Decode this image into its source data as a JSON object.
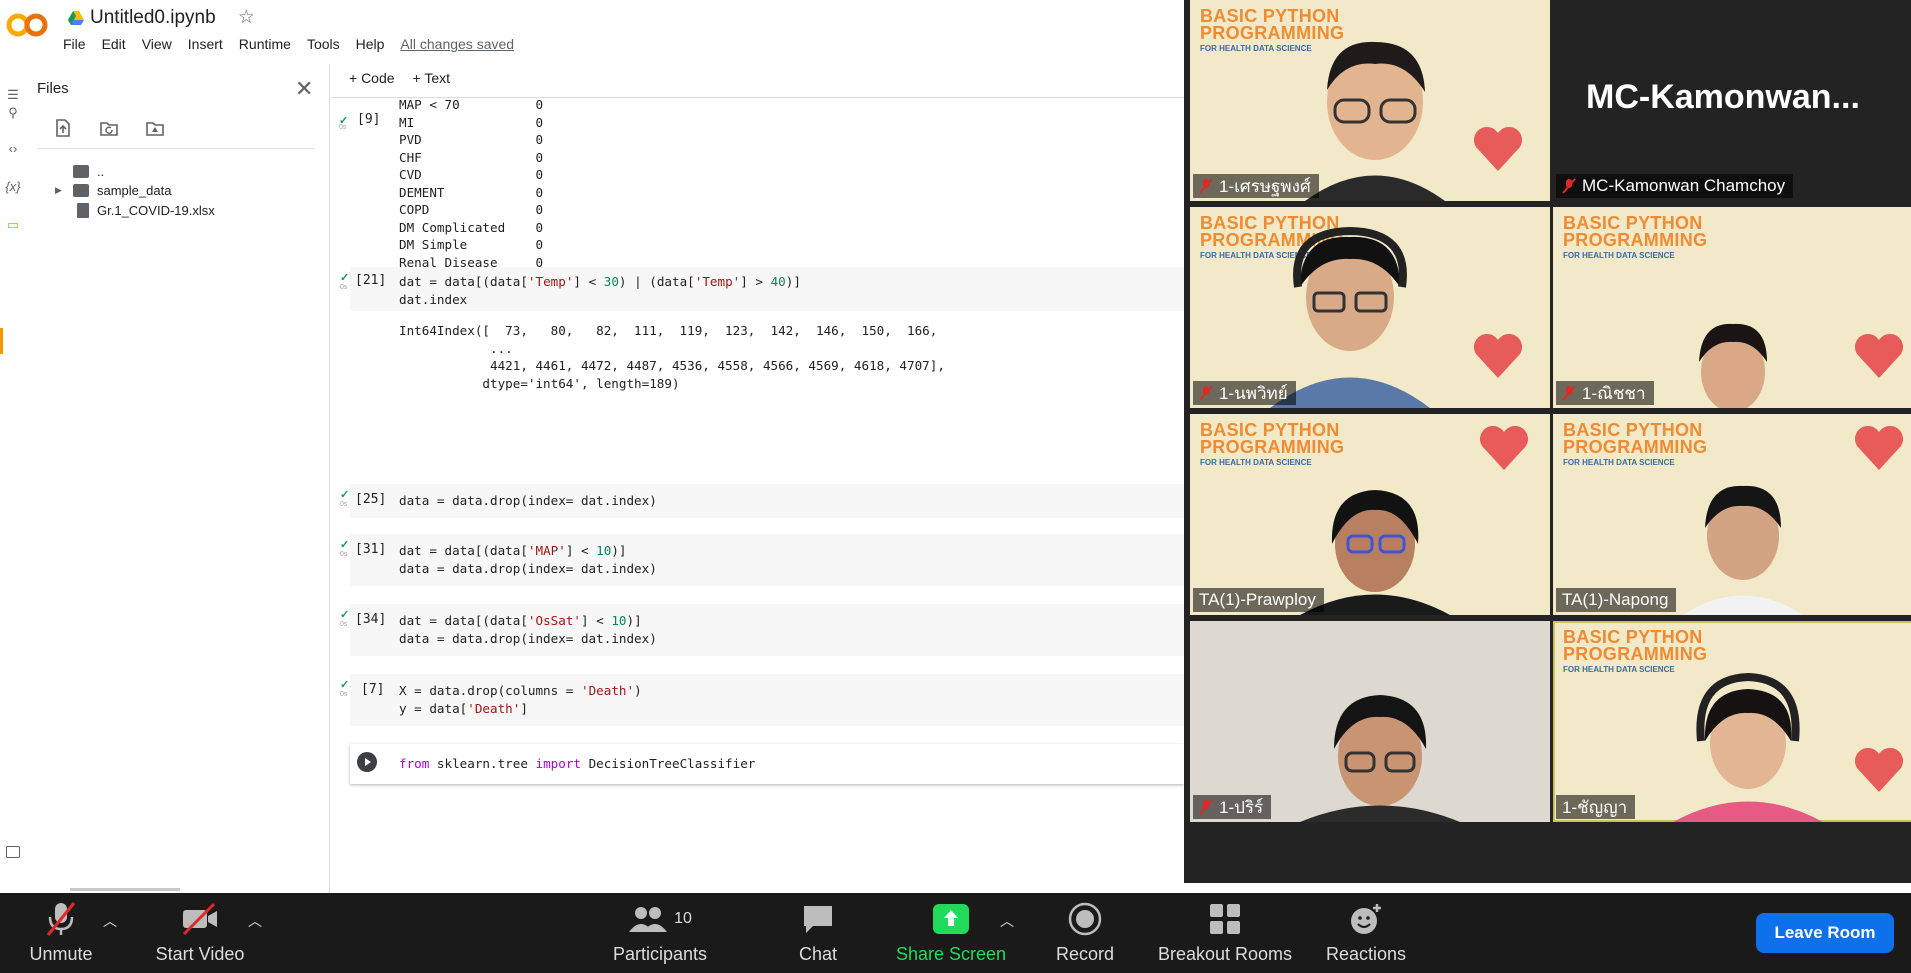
{
  "colab": {
    "title": "Untitled0.ipynb",
    "menu": [
      "File",
      "Edit",
      "View",
      "Insert",
      "Runtime",
      "Tools",
      "Help"
    ],
    "saved_status": "All changes saved",
    "files_panel": {
      "title": "Files",
      "tree": [
        {
          "name": "..",
          "type": "folder-up"
        },
        {
          "name": "sample_data",
          "type": "folder"
        },
        {
          "name": "Gr.1_COVID-19.xlsx",
          "type": "file"
        }
      ]
    },
    "toolbar": {
      "code": "+ Code",
      "text": "+ Text"
    },
    "cells": {
      "c9": {
        "num": "[9]",
        "output": "MAP < 70          0\nMI                0\nPVD               0\nCHF               0\nCVD               0\nDEMENT            0\nCOPD              0\nDM Complicated    0\nDM Simple         0\nRenal Disease     0\nDeath             0\ndtype: int64"
      },
      "c21": {
        "num": "[21]",
        "output": "Int64Index([  73,   80,   82,  111,  119,  123,  142,  146,  150,  166,\n            ...\n            4421, 4461, 4472, 4487, 4536, 4558, 4566, 4569, 4618, 4707],\n           dtype='int64', length=189)"
      },
      "c25": {
        "num": "[25]"
      },
      "c31": {
        "num": "[31]"
      },
      "c34": {
        "num": "[34]"
      },
      "c7": {
        "num": "[7]"
      }
    },
    "sec_label": "0s"
  },
  "zoom": {
    "background_title": "BASIC PYTHON",
    "background_title2": "PROGRAMMING",
    "background_sub": "FOR HEALTH DATA SCIENCE",
    "featured_name": "MC-Kamonwan...",
    "participants": [
      {
        "name": "1-เศรษฐพงศ์",
        "muted": true
      },
      {
        "name": "MC-Kamonwan Chamchoy",
        "muted": true
      },
      {
        "name": "1-นพวิทย์",
        "muted": true
      },
      {
        "name": "1-ณิชชา",
        "muted": true
      },
      {
        "name": "TA(1)-Prawploy",
        "muted": false
      },
      {
        "name": "TA(1)-Napong",
        "muted": false
      },
      {
        "name": "1-ปริร์",
        "muted": true
      },
      {
        "name": "1-ชัญญา",
        "muted": false
      }
    ],
    "bar": {
      "unmute": "Unmute",
      "start_video": "Start Video",
      "participants": "Participants",
      "participants_count": "10",
      "chat": "Chat",
      "share_screen": "Share Screen",
      "record": "Record",
      "breakout": "Breakout Rooms",
      "reactions": "Reactions",
      "leave": "Leave Room"
    },
    "colors": {
      "share_green": "#23d959",
      "leave_blue": "#0e71eb",
      "bar_bg": "#1a1a1a"
    }
  }
}
